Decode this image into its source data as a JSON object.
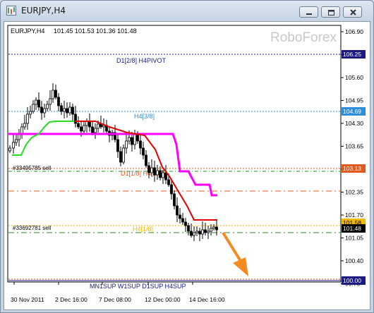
{
  "window": {
    "title": "EURJPY,H4"
  },
  "chart_header": {
    "symbol": "EURJPY,H4",
    "ohlc": "101.45 101.53 101.36 101.48",
    "watermark": "RoboForex"
  },
  "chart_data": {
    "type": "candlestick",
    "symbol": "EURJPY",
    "timeframe": "H4",
    "ohlc": [
      101.45,
      101.53,
      101.36,
      101.48
    ],
    "y_ticks": [
      106.9,
      106.25,
      105.6,
      104.95,
      104.3,
      103.65,
      103.0,
      102.35,
      101.7,
      101.05,
      100.4,
      99.75
    ],
    "x_ticks": [
      "30 Nov 2011",
      "2 Dec 16:00",
      "7 Dec 08:00",
      "12 Dec 00:00",
      "14 Dec 16:00"
    ],
    "ylim": [
      99.7,
      107.1
    ],
    "price_badges": [
      {
        "value": "106.25",
        "color": "#1a1a80"
      },
      {
        "value": "104.69",
        "color": "#2f8fdc"
      },
      {
        "value": "103.13",
        "color": "#e05a1e"
      },
      {
        "value": "101.58",
        "color": "#f5b800"
      },
      {
        "value": "101.48",
        "color": "#000000"
      },
      {
        "value": "100.00",
        "color": "#1a1a80"
      }
    ],
    "levels": [
      {
        "label": "D1[2/8] H4PIVOT",
        "value": 106.25,
        "color": "#1a1a80"
      },
      {
        "label": "H4[3/8]",
        "value": 104.69,
        "color": "#2f8fdc"
      },
      {
        "label": "D1[1/8] H4[2/8]",
        "value": 102.9,
        "color": "#e05a1e"
      },
      {
        "label": "H4[1/8]",
        "value": 101.58,
        "color": "#f5b800"
      },
      {
        "label": "MN1SUP W1SUP D1SUP H4SUP",
        "value": 100.0,
        "color": "#1a1a80"
      }
    ],
    "order_labels": [
      "#33495785 sell",
      "#33692781 sell"
    ]
  }
}
